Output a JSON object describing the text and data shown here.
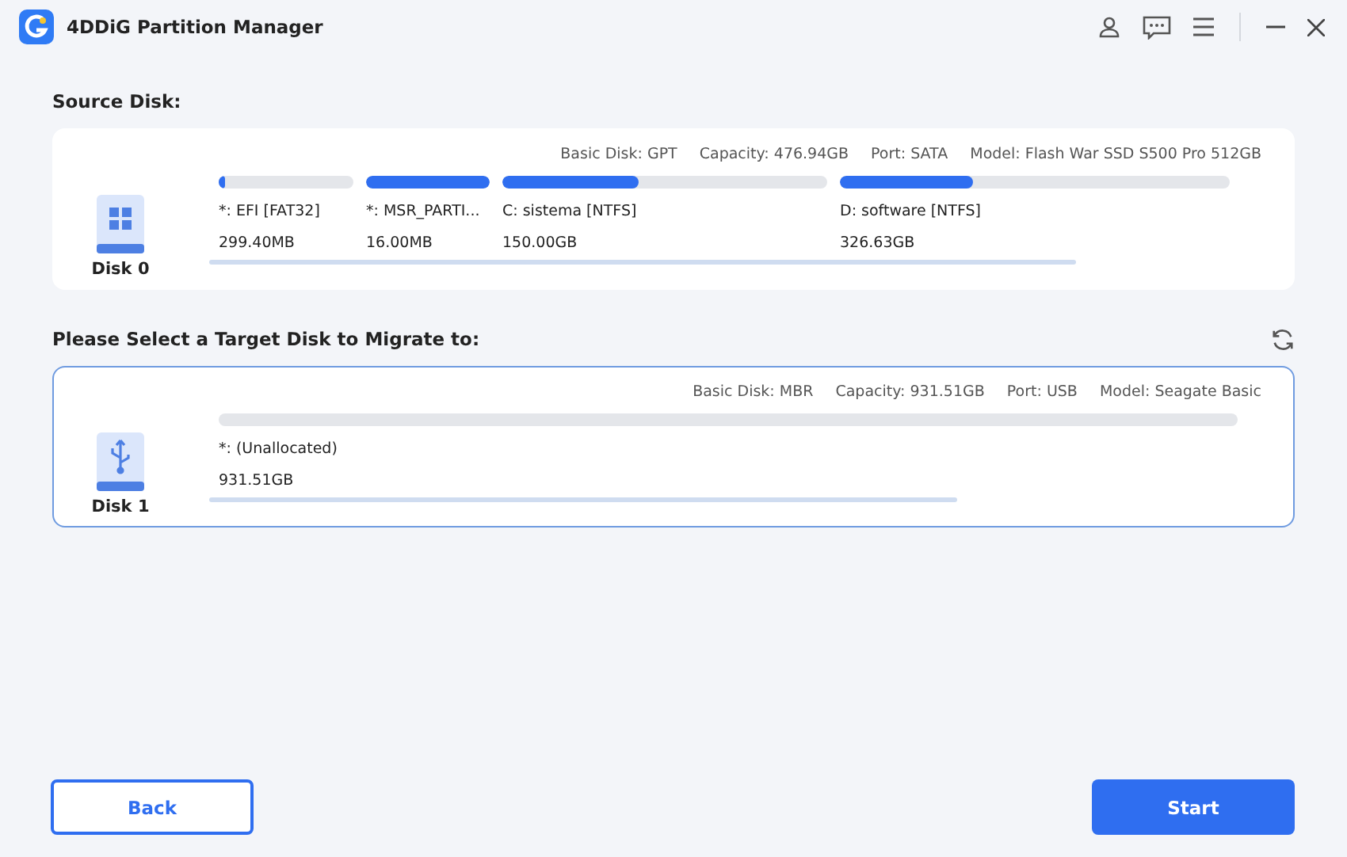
{
  "window": {
    "title": "4DDiG Partition Manager"
  },
  "source": {
    "heading": "Source Disk:",
    "disk": {
      "name": "Disk 0",
      "kind": "windows",
      "selected": false,
      "info": [
        "Basic Disk: GPT",
        "Capacity: 476.94GB",
        "Port: SATA",
        "Model: Flash War SSD S500 Pro 512GB"
      ],
      "partitions": [
        {
          "label": "*: EFI [FAT32]",
          "size": "299.40MB",
          "level": 0.05
        },
        {
          "label": "*: MSR_PARTI...",
          "size": "16.00MB",
          "level": 1
        },
        {
          "label": "C: sistema [NTFS]",
          "size": "150.00GB",
          "level": 0.42
        },
        {
          "label": "D: software [NTFS]",
          "size": "326.63GB",
          "level": 0.34
        }
      ]
    }
  },
  "target": {
    "heading": "Please Select a Target Disk to Migrate to:",
    "disk": {
      "name": "Disk 1",
      "kind": "usb",
      "selected": true,
      "info": [
        "Basic Disk: MBR",
        "Capacity: 931.51GB",
        "Port: USB",
        "Model: Seagate Basic"
      ],
      "partitions": [
        {
          "label": "*: (Unallocated)",
          "size": "931.51GB"
        }
      ]
    }
  },
  "buttons": {
    "back": "Back",
    "start": "Start"
  }
}
